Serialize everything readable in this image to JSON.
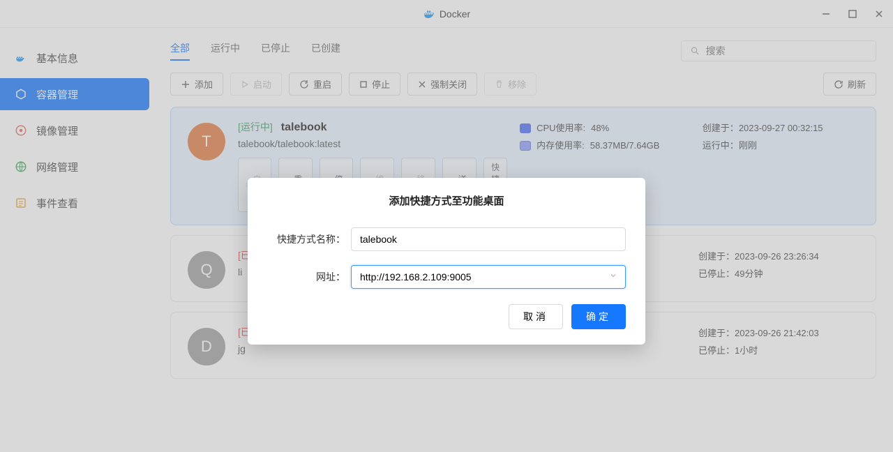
{
  "window": {
    "title": "Docker"
  },
  "sidebar": {
    "items": [
      {
        "label": "基本信息",
        "icon": "info"
      },
      {
        "label": "容器管理",
        "icon": "container",
        "active": true
      },
      {
        "label": "镜像管理",
        "icon": "image"
      },
      {
        "label": "网络管理",
        "icon": "network"
      },
      {
        "label": "事件查看",
        "icon": "events"
      }
    ]
  },
  "tabs": [
    {
      "label": "全部",
      "active": true
    },
    {
      "label": "运行中"
    },
    {
      "label": "已停止"
    },
    {
      "label": "已创建"
    }
  ],
  "search": {
    "placeholder": "搜索"
  },
  "toolbar": {
    "add": "添加",
    "start": "启动",
    "restart": "重启",
    "stop": "停止",
    "kill": "强制关闭",
    "remove": "移除",
    "refresh": "刷新"
  },
  "containers": [
    {
      "avatar": "T",
      "avatar_class": "t",
      "status": "[运行中]",
      "name": "talebook",
      "image": "talebook/talebook:latest",
      "cpu_label": "CPU使用率:",
      "cpu_value": "48%",
      "mem_label": "内存使用率:",
      "mem_value": "58.37MB/7.64GB",
      "created_label": "创建于：",
      "created_value": "2023-09-27 00:32:15",
      "run_label": "运行中：",
      "run_value": "刚刚",
      "selected": true,
      "actions": {
        "start": "启动",
        "restart": "重启",
        "stop": "停止",
        "edit": "编辑",
        "remove": "移除",
        "detail": "详情",
        "shortcut": "快捷方式"
      }
    },
    {
      "avatar": "Q",
      "avatar_class": "q",
      "status": "[已",
      "name_partial": "li",
      "created_label": "创建于：",
      "created_value": "2023-09-26 23:26:34",
      "run_label": "已停止：",
      "run_value": "49分钟"
    },
    {
      "avatar": "D",
      "avatar_class": "d",
      "status": "[已",
      "name_partial": "jg",
      "created_label": "创建于：",
      "created_value": "2023-09-26 21:42:03",
      "run_label": "已停止：",
      "run_value": "1小时"
    }
  ],
  "modal": {
    "title": "添加快捷方式至功能桌面",
    "name_label": "快捷方式名称：",
    "name_value": "talebook",
    "url_label": "网址：",
    "url_value": "http://192.168.2.109:9005",
    "cancel": "取消",
    "confirm": "确定"
  }
}
